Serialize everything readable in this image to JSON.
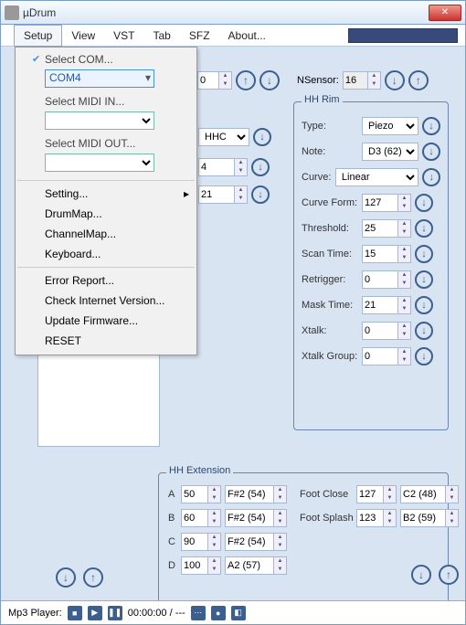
{
  "window": {
    "title": "µDrum"
  },
  "menubar": {
    "items": [
      "Setup",
      "View",
      "VST",
      "Tab",
      "SFZ",
      "About..."
    ]
  },
  "setup_menu": {
    "select_com": "Select COM...",
    "com_value": "COM4",
    "select_midi_in": "Select MIDI IN...",
    "midi_in_value": "",
    "select_midi_out": "Select MIDI OUT...",
    "midi_out_value": "",
    "setting": "Setting...",
    "drummap": "DrumMap...",
    "channelmap": "ChannelMap...",
    "keyboard": "Keyboard...",
    "error_report": "Error Report...",
    "check_version": "Check Internet Version...",
    "update_firmware": "Update Firmware...",
    "reset": "RESET"
  },
  "header": {
    "val0": "0",
    "nsensor_label": "NSensor:",
    "nsensor_value": "16"
  },
  "bg": {
    "combo1": "HHC",
    "val4": "4",
    "val21": "21"
  },
  "hh_rim": {
    "legend": "HH Rim",
    "type_label": "Type:",
    "type_value": "Piezo",
    "note_label": "Note:",
    "note_value": "D3 (62)",
    "curve_label": "Curve:",
    "curve_value": "Linear",
    "curveform_label": "Curve Form:",
    "curveform_value": "127",
    "threshold_label": "Threshold:",
    "threshold_value": "25",
    "scantime_label": "Scan Time:",
    "scantime_value": "15",
    "retrigger_label": "Retrigger:",
    "retrigger_value": "0",
    "masktime_label": "Mask Time:",
    "masktime_value": "21",
    "xtalk_label": "Xtalk:",
    "xtalk_value": "0",
    "xtalkgroup_label": "Xtalk Group:",
    "xtalkgroup_value": "0"
  },
  "hh_ext": {
    "legend": "HH Extension",
    "rows": [
      {
        "lbl": "A",
        "v": "50",
        "n": "F#2 (54)"
      },
      {
        "lbl": "B",
        "v": "60",
        "n": "F#2 (54)"
      },
      {
        "lbl": "C",
        "v": "90",
        "n": "F#2 (54)"
      },
      {
        "lbl": "D",
        "v": "100",
        "n": "A2 (57)"
      }
    ],
    "foot_close_label": "Foot Close",
    "foot_close_v": "127",
    "foot_close_n": "C2 (48)",
    "foot_splash_label": "Foot Splash",
    "foot_splash_v": "123",
    "foot_splash_n": "B2 (59)"
  },
  "statusbar": {
    "label": "Mp3 Player:",
    "time": "00:00:00 / ---"
  }
}
